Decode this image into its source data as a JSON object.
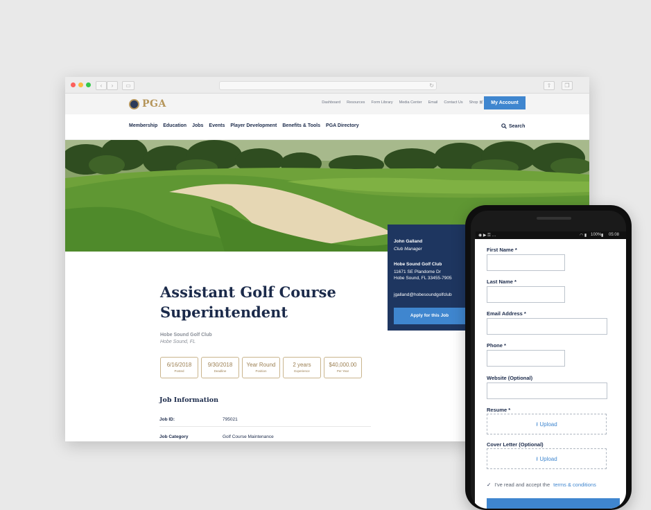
{
  "site": {
    "logo_text": "PGA"
  },
  "util_links": [
    "Dashboard",
    "Resources",
    "Form Library",
    "Media Center",
    "Email",
    "Contact Us",
    "Shop"
  ],
  "my_account": "My Account",
  "nav": [
    "Membership",
    "Education",
    "Jobs",
    "Events",
    "Player Development",
    "Benefits & Tools",
    "PGA Directory"
  ],
  "search_label": "Search",
  "contact": {
    "name": "John Galland",
    "role": "Club Manager",
    "club": "Hobe Sound Golf Club",
    "address_line1": "11671 SE Plandome Dr",
    "address_line2": "Hobe Sound, FL 33455-7905",
    "email": "jgalland@hobesoundgolfclub",
    "apply_label": "Apply for this Job"
  },
  "job": {
    "title": "Assistant Golf Course Superintendent",
    "club": "Hobe Sound Golf Club",
    "location": "Hobe Sound, FL",
    "stats": [
      {
        "value": "6/16/2018",
        "label": "Posted"
      },
      {
        "value": "9/30/2018",
        "label": "Deadline"
      },
      {
        "value": "Year Round",
        "label": "Position"
      },
      {
        "value": "2 years",
        "label": "Experience"
      },
      {
        "value": "$40,000.00",
        "label": "Per Year"
      }
    ],
    "info_title": "Job Information",
    "info_rows": [
      {
        "key": "Job ID:",
        "value": "795021"
      },
      {
        "key": "Job Category",
        "value": "Golf Course Maintenance"
      }
    ]
  },
  "mobile": {
    "time": "05:08",
    "battery": "100%",
    "fields": [
      {
        "label": "First Name *"
      },
      {
        "label": "Last Name *"
      },
      {
        "label": "Email Address *"
      },
      {
        "label": "Phone *"
      },
      {
        "label": "Website (Optional)"
      }
    ],
    "resume_label": "Resume *",
    "cover_label": "Cover Letter (Optional)",
    "upload_label": "Upload",
    "terms_prefix": "I've read and accept the",
    "terms_link": "terms & conditions"
  },
  "colors": {
    "navy": "#1e3660",
    "accent": "#3f86cf",
    "gold": "#b5955a"
  }
}
